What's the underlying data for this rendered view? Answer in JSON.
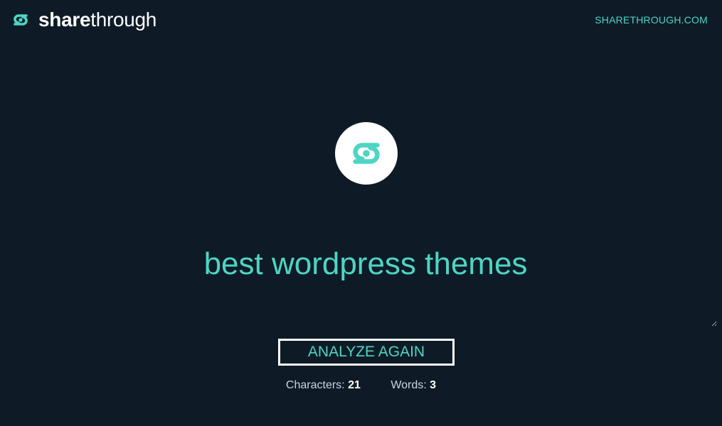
{
  "header": {
    "brand_bold": "share",
    "brand_light": "through",
    "site_link": "SHARETHROUGH.COM"
  },
  "main": {
    "query_text": "best wordpress themes",
    "analyze_button": "ANALYZE AGAIN",
    "stats": {
      "characters_label": "Characters:",
      "characters_value": "21",
      "words_label": "Words:",
      "words_value": "3"
    }
  },
  "colors": {
    "background": "#0e1b27",
    "accent": "#4ed5c4",
    "text_muted": "#c9d4dc",
    "white": "#ffffff"
  },
  "icons": {
    "brand": "sharethrough-logo-icon",
    "center": "sharethrough-logo-icon"
  }
}
